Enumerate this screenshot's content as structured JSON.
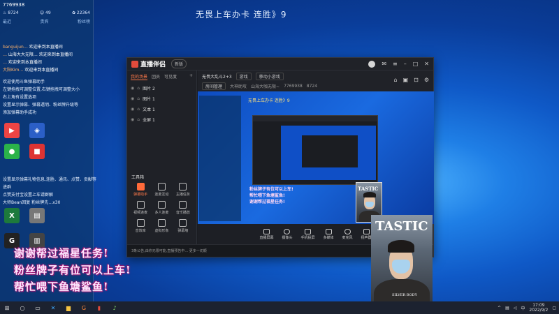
{
  "stream_title": "无畏上车办卡 连胜》9",
  "chat": {
    "room_id": "7769938",
    "stats": [
      {
        "icon": "fire-icon",
        "value": "8724"
      },
      {
        "icon": "user-icon",
        "value": "49"
      },
      {
        "icon": "gift-icon",
        "value": "22364"
      }
    ],
    "tabs": [
      "最近",
      "贵宾",
      "粉丝榜"
    ],
    "messages": [
      {
        "user": "banguijun…",
        "text": "欢迎来到本直播间"
      },
      {
        "user": "…",
        "text": "山海大大无限… 欢迎来到本直播间"
      },
      {
        "user": "…",
        "text": "欢迎来到本直播间"
      },
      {
        "user": "大阳Kim…",
        "text": "欢迎来到本直播间"
      }
    ],
    "system_lines": [
      "欢迎使用斗鱼弹幕助手",
      "左键拖拽可调整位置,右键拖拽可调整大小",
      "右上角有设置选项",
      "设置显示弹幕、弹幕透明、粉丝牌升级等",
      "添加弹幕助手成功"
    ],
    "later_lines": [
      "设置显示弹幕礼物信息,连胜、通讯、点赞、贡献等",
      "进群",
      "点赞支付宝设置上车请群解",
      "大师Bean回复 粉丝牌先…x30"
    ]
  },
  "subtitles": [
    "谢谢帮过福星任务!",
    "粉丝牌子有位可以上车!",
    "帮忙喂下鱼塘鲨鱼!"
  ],
  "app": {
    "name": "直播伴侣",
    "version": "新版",
    "sidebar_tabs": [
      "我的场景",
      "团员",
      "可见度"
    ],
    "layers": [
      {
        "type": "图片",
        "name": "图片 2"
      },
      {
        "type": "图片",
        "name": "图片 1"
      },
      {
        "type": "文本",
        "name": "文本 1"
      },
      {
        "type": "全屏",
        "name": "全屏 1"
      }
    ],
    "tools_title": "工具箱",
    "tools": [
      "弹幕助手",
      "连麦互动",
      "主播任务",
      "视频连麦",
      "多人连麦",
      "音乐播放",
      "音效库",
      "虚拟形象",
      "弹幕墙"
    ],
    "room_title": "无畏大乱斗2+3",
    "room_tag": "游戏",
    "room_type": "移动小游戏",
    "room_meta": [
      "房间管理",
      "大神助攻",
      "山海大咖无限~",
      "7769938",
      "8724"
    ],
    "controls": [
      "直播屏幕",
      "摄像头",
      "手机投屏",
      "多媒体",
      "麦克风",
      "扬声器"
    ],
    "status_text": "3条公告,由你无限可能,直播预告中... 更多一切顺"
  },
  "preview": {
    "inner_overlay": [
      "粉丝牌子有位可以上车!",
      "帮忙喂下鱼塘鲨鱼!",
      "谢谢帮过福星任务!"
    ]
  },
  "cam_tag": "TASTIC",
  "cam_tag_small": "SILVER BODY",
  "taskbar": {
    "time": "17:09",
    "date": "2022/9/2"
  }
}
